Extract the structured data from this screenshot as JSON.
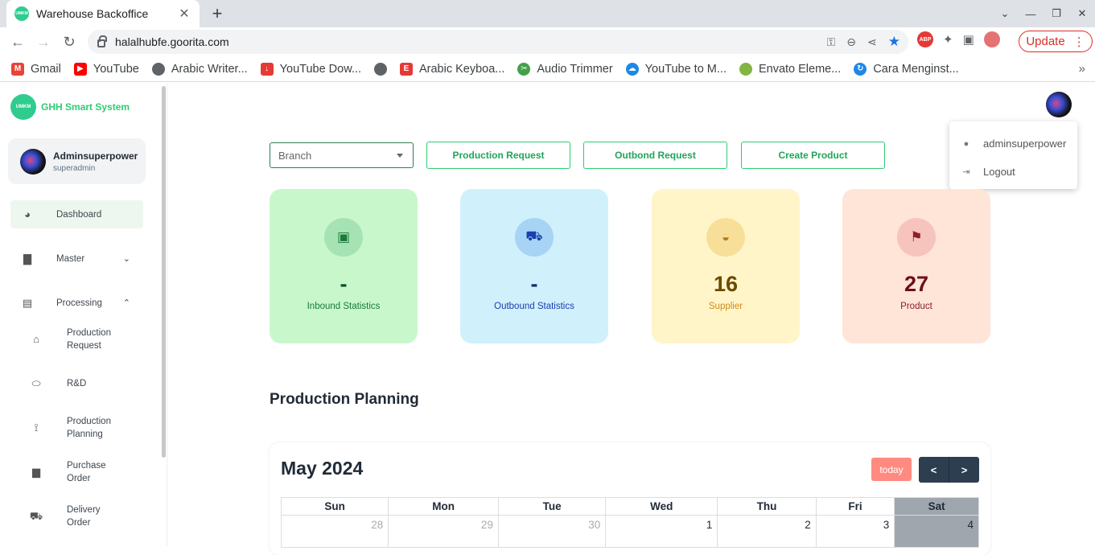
{
  "browser": {
    "tab_title": "Warehouse Backoffice",
    "url": "halalhubfe.goorita.com",
    "update_label": "Update",
    "bookmarks": [
      {
        "label": "Gmail",
        "icon": "gmail-icon",
        "color": "#ea4335"
      },
      {
        "label": "YouTube",
        "icon": "youtube-icon",
        "color": "#ff0000"
      },
      {
        "label": "Arabic Writer...",
        "icon": "globe-icon",
        "color": "#5f6368"
      },
      {
        "label": "YouTube Dow...",
        "icon": "download-icon",
        "color": "#e53935"
      },
      {
        "label": "",
        "icon": "globe-icon",
        "color": "#5f6368"
      },
      {
        "label": "Arabic Keyboa...",
        "icon": "keyboard-icon",
        "color": "#e53935"
      },
      {
        "label": "Audio Trimmer",
        "icon": "scissors-icon",
        "color": "#43a047"
      },
      {
        "label": "YouTube to M...",
        "icon": "cloud-icon",
        "color": "#1e88e5"
      },
      {
        "label": "Envato Eleme...",
        "icon": "leaf-icon",
        "color": "#82b541"
      },
      {
        "label": "Cara Menginst...",
        "icon": "refresh-icon",
        "color": "#1e88e5"
      }
    ]
  },
  "app": {
    "brand_name": "GHH Smart System",
    "brand_logo_text": "UMKM",
    "user": {
      "name": "Adminsuperpower",
      "role": "superadmin"
    },
    "nav": {
      "dashboard": "Dashboard",
      "master": "Master",
      "processing": "Processing",
      "sub": {
        "production_request": "Production Request",
        "rnd": "R&D",
        "production_planning": "Production Planning",
        "purchase_order": "Purchase Order",
        "delivery_order": "Delivery Order"
      }
    },
    "dropdown": {
      "username": "adminsuperpower",
      "logout": "Logout"
    },
    "branch_placeholder": "Branch",
    "actions": {
      "production_request": "Production Request",
      "outbond_request": "Outbond Request",
      "create_product": "Create Product"
    },
    "stats": [
      {
        "value": "-",
        "label": "Inbound Statistics",
        "bg": "#c8f7cc",
        "icon_bg": "#a5e3b4",
        "value_color": "#0b4d2a",
        "label_color": "#1b7a3a",
        "icon": "briefcase-icon"
      },
      {
        "value": "-",
        "label": "Outbound Statistics",
        "bg": "#d0f0fc",
        "icon_bg": "#a7d4f5",
        "value_color": "#0c2d6b",
        "label_color": "#1a3fb0",
        "icon": "truck-icon"
      },
      {
        "value": "16",
        "label": "Supplier",
        "bg": "#fff5c8",
        "icon_bg": "#f7df9a",
        "value_color": "#6b4a00",
        "label_color": "#d08a1a",
        "icon": "basket-icon"
      },
      {
        "value": "27",
        "label": "Product",
        "bg": "#ffe4d8",
        "icon_bg": "#f7c3bd",
        "value_color": "#6b0f1a",
        "label_color": "#8a1f2a",
        "icon": "fastfood-icon"
      }
    ],
    "section_title": "Production Planning",
    "calendar": {
      "title": "May 2024",
      "today_label": "today",
      "weekdays": [
        "Sun",
        "Mon",
        "Tue",
        "Wed",
        "Thu",
        "Fri",
        "Sat"
      ],
      "first_row": [
        "28",
        "29",
        "30",
        "1",
        "2",
        "3",
        "4"
      ]
    }
  }
}
